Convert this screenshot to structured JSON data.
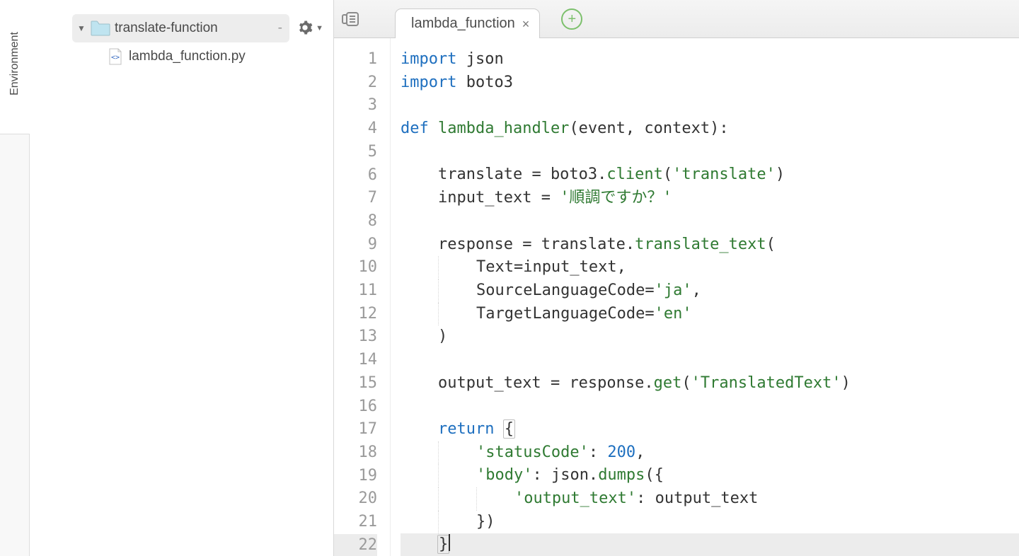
{
  "sidebar": {
    "env_label": "Environment"
  },
  "tree": {
    "root_name": "translate-function",
    "child_name": "lambda_function.py"
  },
  "tabs": {
    "active_label": "lambda_function"
  },
  "code": {
    "line_count": 22,
    "active_line": 22,
    "lines": [
      [
        {
          "t": "kw",
          "v": "import"
        },
        {
          "t": "sp",
          "v": " "
        },
        {
          "t": "name",
          "v": "json"
        }
      ],
      [
        {
          "t": "kw",
          "v": "import"
        },
        {
          "t": "sp",
          "v": " "
        },
        {
          "t": "name",
          "v": "boto3"
        }
      ],
      [],
      [
        {
          "t": "kw",
          "v": "def"
        },
        {
          "t": "sp",
          "v": " "
        },
        {
          "t": "fn",
          "v": "lambda_handler"
        },
        {
          "t": "op",
          "v": "(event, context):"
        }
      ],
      [
        {
          "t": "indent",
          "v": 1
        }
      ],
      [
        {
          "t": "indent",
          "v": 1
        },
        {
          "t": "name",
          "v": "translate "
        },
        {
          "t": "op",
          "v": "= "
        },
        {
          "t": "name",
          "v": "boto3."
        },
        {
          "t": "fn",
          "v": "client"
        },
        {
          "t": "op",
          "v": "("
        },
        {
          "t": "str",
          "v": "'translate'"
        },
        {
          "t": "op",
          "v": ")"
        }
      ],
      [
        {
          "t": "indent",
          "v": 1
        },
        {
          "t": "name",
          "v": "input_text "
        },
        {
          "t": "op",
          "v": "= "
        },
        {
          "t": "str",
          "v": "'順調ですか？'"
        }
      ],
      [
        {
          "t": "indent",
          "v": 1
        }
      ],
      [
        {
          "t": "indent",
          "v": 1
        },
        {
          "t": "name",
          "v": "response "
        },
        {
          "t": "op",
          "v": "= "
        },
        {
          "t": "name",
          "v": "translate."
        },
        {
          "t": "fn",
          "v": "translate_text"
        },
        {
          "t": "op",
          "v": "("
        }
      ],
      [
        {
          "t": "indent",
          "v": 2
        },
        {
          "t": "name",
          "v": "Text"
        },
        {
          "t": "op",
          "v": "=input_text,"
        }
      ],
      [
        {
          "t": "indent",
          "v": 2
        },
        {
          "t": "name",
          "v": "SourceLanguageCode"
        },
        {
          "t": "op",
          "v": "="
        },
        {
          "t": "str",
          "v": "'ja'"
        },
        {
          "t": "op",
          "v": ","
        }
      ],
      [
        {
          "t": "indent",
          "v": 2
        },
        {
          "t": "name",
          "v": "TargetLanguageCode"
        },
        {
          "t": "op",
          "v": "="
        },
        {
          "t": "str",
          "v": "'en'"
        }
      ],
      [
        {
          "t": "indent",
          "v": 1
        },
        {
          "t": "op",
          "v": ")"
        }
      ],
      [
        {
          "t": "indent",
          "v": 1
        }
      ],
      [
        {
          "t": "indent",
          "v": 1
        },
        {
          "t": "name",
          "v": "output_text "
        },
        {
          "t": "op",
          "v": "= "
        },
        {
          "t": "name",
          "v": "response."
        },
        {
          "t": "fn",
          "v": "get"
        },
        {
          "t": "op",
          "v": "("
        },
        {
          "t": "str",
          "v": "'TranslatedText'"
        },
        {
          "t": "op",
          "v": ")"
        }
      ],
      [
        {
          "t": "indent",
          "v": 1
        }
      ],
      [
        {
          "t": "indent",
          "v": 1
        },
        {
          "t": "kw",
          "v": "return"
        },
        {
          "t": "sp",
          "v": " "
        },
        {
          "t": "op-hl",
          "v": "{"
        }
      ],
      [
        {
          "t": "indent",
          "v": 2
        },
        {
          "t": "str",
          "v": "'statusCode'"
        },
        {
          "t": "op",
          "v": ": "
        },
        {
          "t": "num",
          "v": "200"
        },
        {
          "t": "op",
          "v": ","
        }
      ],
      [
        {
          "t": "indent",
          "v": 2
        },
        {
          "t": "str",
          "v": "'body'"
        },
        {
          "t": "op",
          "v": ": "
        },
        {
          "t": "name",
          "v": "json."
        },
        {
          "t": "fn",
          "v": "dumps"
        },
        {
          "t": "op",
          "v": "({"
        }
      ],
      [
        {
          "t": "indent",
          "v": 3
        },
        {
          "t": "str",
          "v": "'output_text'"
        },
        {
          "t": "op",
          "v": ": "
        },
        {
          "t": "name",
          "v": "output_text"
        }
      ],
      [
        {
          "t": "indent",
          "v": 2
        },
        {
          "t": "op",
          "v": "})"
        }
      ],
      [
        {
          "t": "indent",
          "v": 1
        },
        {
          "t": "op-hl",
          "v": "}"
        },
        {
          "t": "cursor",
          "v": ""
        }
      ]
    ]
  }
}
